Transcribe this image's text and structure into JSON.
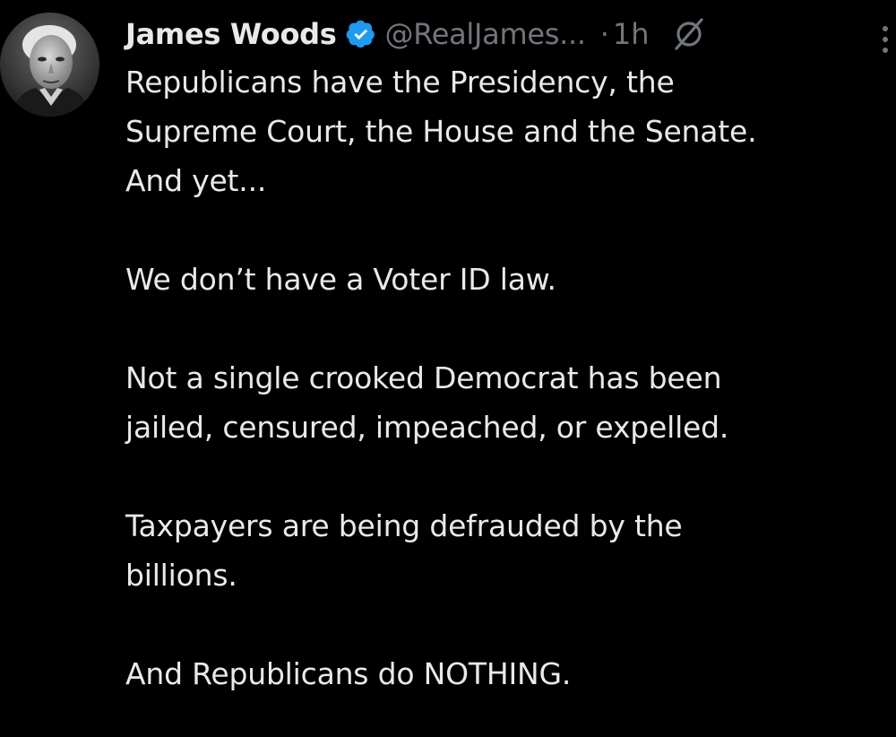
{
  "author": {
    "display_name": "James Woods",
    "handle": "@RealJames...",
    "separator": "·",
    "time": "1h",
    "verified": true
  },
  "colors": {
    "background": "#000000",
    "text": "#e7e9ea",
    "muted": "#71767b",
    "verified_blue": "#1d9bf0"
  },
  "icons": {
    "verified": "verified-badge-icon",
    "grok": "grok-icon",
    "more": "more-options-icon"
  },
  "tweet": {
    "paragraphs": [
      {
        "lines": [
          "Republicans have the Presidency, the",
          "Supreme Court, the House and the Senate.",
          "And yet..."
        ]
      },
      {
        "lines": [
          "We don’t have a Voter ID law."
        ]
      },
      {
        "lines": [
          "Not a single crooked Democrat has been",
          "jailed, censured, impeached, or expelled."
        ]
      },
      {
        "lines": [
          "Taxpayers are being defrauded by the",
          "billions."
        ]
      },
      {
        "lines": [
          "And Republicans do NOTHING."
        ]
      }
    ]
  }
}
